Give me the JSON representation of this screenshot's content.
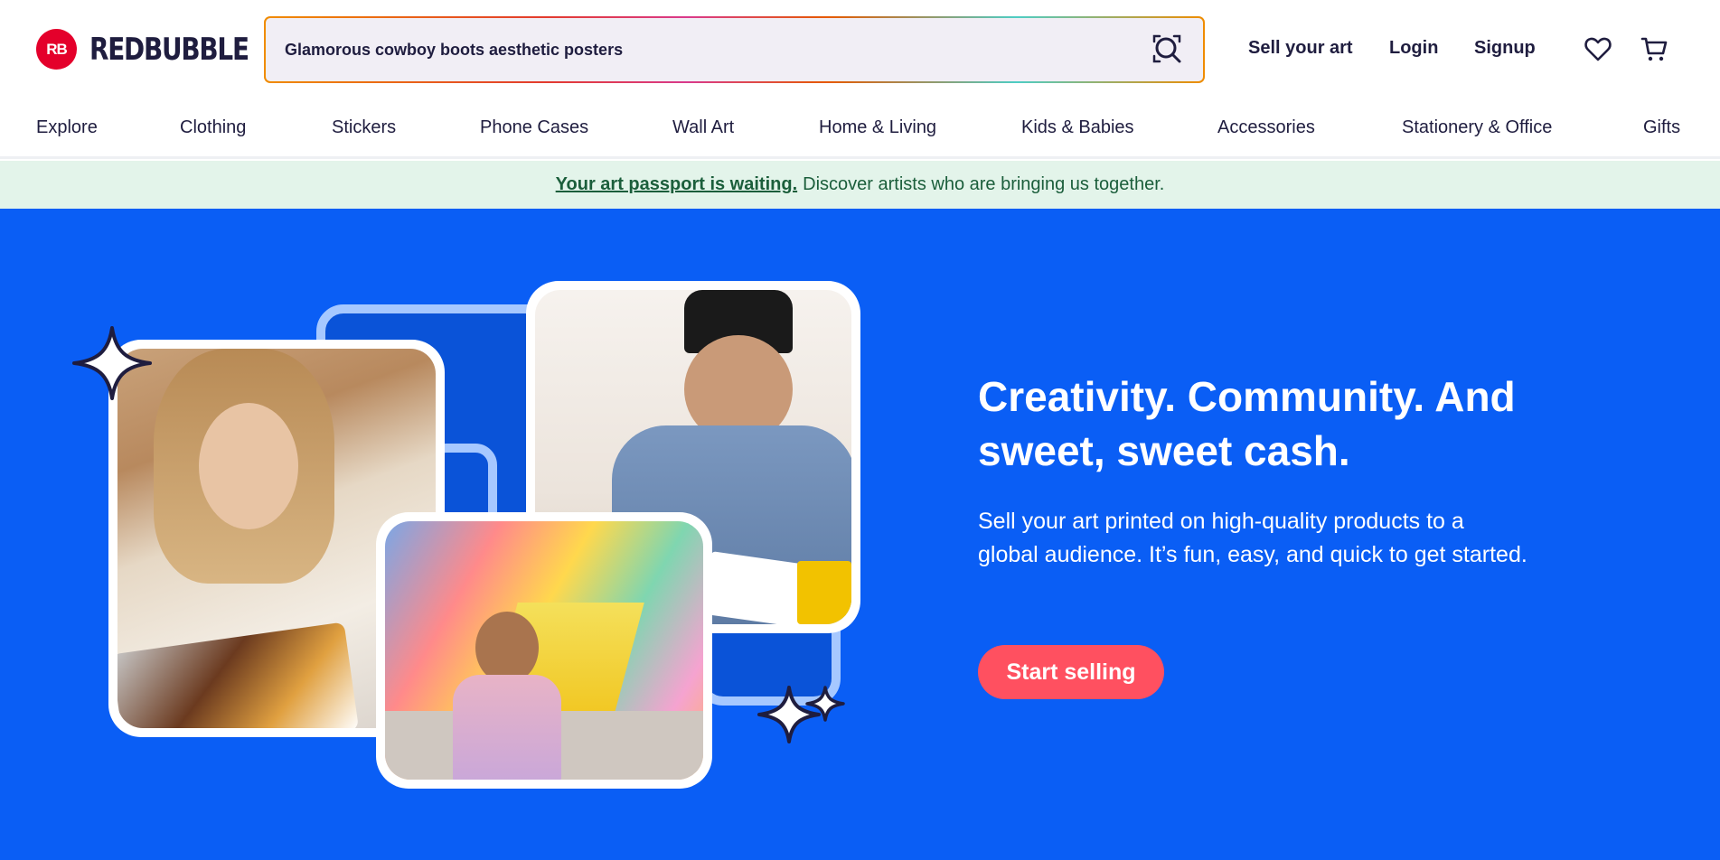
{
  "header": {
    "logo_text": "REDBUBBLE",
    "logo_mark": "RB",
    "search_value": "Glamorous cowboy boots aesthetic posters",
    "links": {
      "sell": "Sell your art",
      "login": "Login",
      "signup": "Signup"
    },
    "icons": [
      "visual-search-icon",
      "heart-icon",
      "cart-icon"
    ]
  },
  "categories": [
    "Explore",
    "Clothing",
    "Stickers",
    "Phone Cases",
    "Wall Art",
    "Home & Living",
    "Kids & Babies",
    "Accessories",
    "Stationery & Office",
    "Gifts"
  ],
  "banner": {
    "link_text": "Your art passport is waiting.",
    "text": "Discover artists who are bringing us together."
  },
  "hero": {
    "title": "Creativity. Community. And sweet, sweet cash.",
    "subtitle": "Sell your art printed on high-quality products to a global audience. It’s fun, easy, and quick to get started.",
    "cta": "Start selling"
  },
  "colors": {
    "brand_red": "#e4002b",
    "hero_blue": "#0a5ef5",
    "cta_pink": "#ff5060",
    "banner_green_bg": "#e3f4ea",
    "text_dark": "#1f1d3f"
  }
}
